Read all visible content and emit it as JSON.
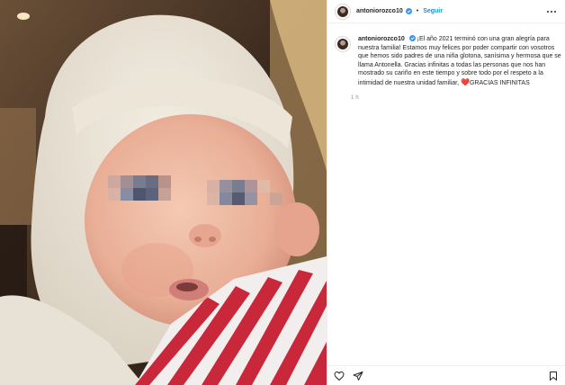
{
  "post": {
    "username": "antoniorozco10",
    "follow_label": "Seguir",
    "separator": "•",
    "caption": "¡El año 2021 terminó con una gran alegría para nuestra familia! Estamos muy felices por poder compartir con vosotros que hemos sido padres de una niña glotona, sanísima y hermosa que se llama Antonella. Gracias infinitas a todas las personas que nos han mostrado su cariño en este tiempo y sobre todo por el respeto a la intimidad de nuestra unidad familiar, ",
    "caption_end": "GRACIAS INFINITAS",
    "heart_glyph": "❤️",
    "time_ago": "1 h"
  },
  "icons": {
    "verified": "verified-badge",
    "more": "more-options",
    "like": "heart-outline",
    "share": "paper-plane",
    "save": "bookmark-outline"
  },
  "colors": {
    "accent": "#0095f6",
    "verified": "#3897f0",
    "heart": "#ed4956",
    "muted": "#8e8e8e"
  }
}
